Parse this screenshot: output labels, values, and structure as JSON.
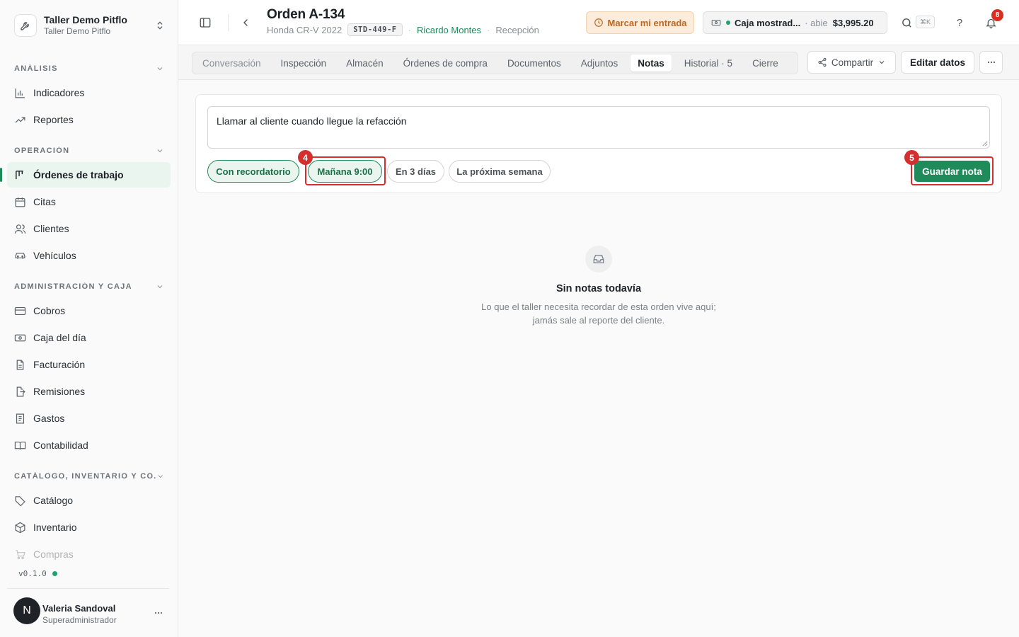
{
  "workspace": {
    "name": "Taller Demo Pitflo",
    "subtitle": "Taller Demo Pitflo"
  },
  "sidebar": {
    "sections": [
      {
        "label": "ANÁLISIS",
        "items": [
          {
            "label": "Indicadores",
            "icon": "bar-chart-icon"
          },
          {
            "label": "Reportes",
            "icon": "trend-up-icon"
          }
        ]
      },
      {
        "label": "OPERACIÓN",
        "items": [
          {
            "label": "Órdenes de trabajo",
            "icon": "kanban-icon",
            "active": true
          },
          {
            "label": "Citas",
            "icon": "calendar-icon"
          },
          {
            "label": "Clientes",
            "icon": "users-icon"
          },
          {
            "label": "Vehículos",
            "icon": "car-icon"
          }
        ]
      },
      {
        "label": "ADMINISTRACIÓN Y CAJA",
        "items": [
          {
            "label": "Cobros",
            "icon": "credit-card-icon"
          },
          {
            "label": "Caja del día",
            "icon": "cash-register-icon"
          },
          {
            "label": "Facturación",
            "icon": "file-text-icon"
          },
          {
            "label": "Remisiones",
            "icon": "file-export-icon"
          },
          {
            "label": "Gastos",
            "icon": "receipt-icon"
          },
          {
            "label": "Contabilidad",
            "icon": "book-open-icon"
          }
        ]
      },
      {
        "label": "CATÁLOGO, INVENTARIO Y CO...",
        "items": [
          {
            "label": "Catálogo",
            "icon": "tags-icon"
          },
          {
            "label": "Inventario",
            "icon": "package-icon"
          },
          {
            "label": "Compras",
            "icon": "cart-icon"
          }
        ]
      }
    ],
    "version": "v0.1.0"
  },
  "user": {
    "initial": "N",
    "name": "Valeria Sandoval",
    "role": "Superadministrador"
  },
  "header": {
    "title": "Orden A-134",
    "vehicle": "Honda CR-V 2022",
    "plate": "STD-449-F",
    "customer": "Ricardo Montes",
    "stage": "Recepción",
    "clock_in_label": "Marcar mi entrada",
    "register": {
      "name": "Caja mostrad...",
      "status": "abie",
      "amount": "$3,995.20"
    },
    "search_shortcut": "⌘K",
    "notifications_count": "8"
  },
  "tabs": [
    {
      "label": "Conversación"
    },
    {
      "label": "Inspección"
    },
    {
      "label": "Almacén"
    },
    {
      "label": "Órdenes de compra"
    },
    {
      "label": "Documentos"
    },
    {
      "label": "Adjuntos"
    },
    {
      "label": "Notas",
      "active": true
    },
    {
      "label": "Historial · 5"
    },
    {
      "label": "Cierre"
    }
  ],
  "actions": {
    "share_label": "Compartir",
    "edit_label": "Editar datos"
  },
  "note_form": {
    "text": "Llamar al cliente cuando llegue la refacción",
    "chips": [
      {
        "label": "Con recordatorio",
        "selected": true
      },
      {
        "label": "Mañana 9:00",
        "selected": true
      },
      {
        "label": "En 3 días",
        "selected": false
      },
      {
        "label": "La próxima semana",
        "selected": false
      }
    ],
    "save_label": "Guardar nota"
  },
  "annotations": [
    {
      "step": "4"
    },
    {
      "step": "5"
    }
  ],
  "empty_state": {
    "title": "Sin notas todavía",
    "line1": "Lo que el taller necesita recordar de esta orden vive aquí;",
    "line2": "jamás sale al reporte del cliente."
  },
  "colors": {
    "accent": "#1f8a5a",
    "highlight": "#d32f2f",
    "warning": "#c0671d"
  }
}
